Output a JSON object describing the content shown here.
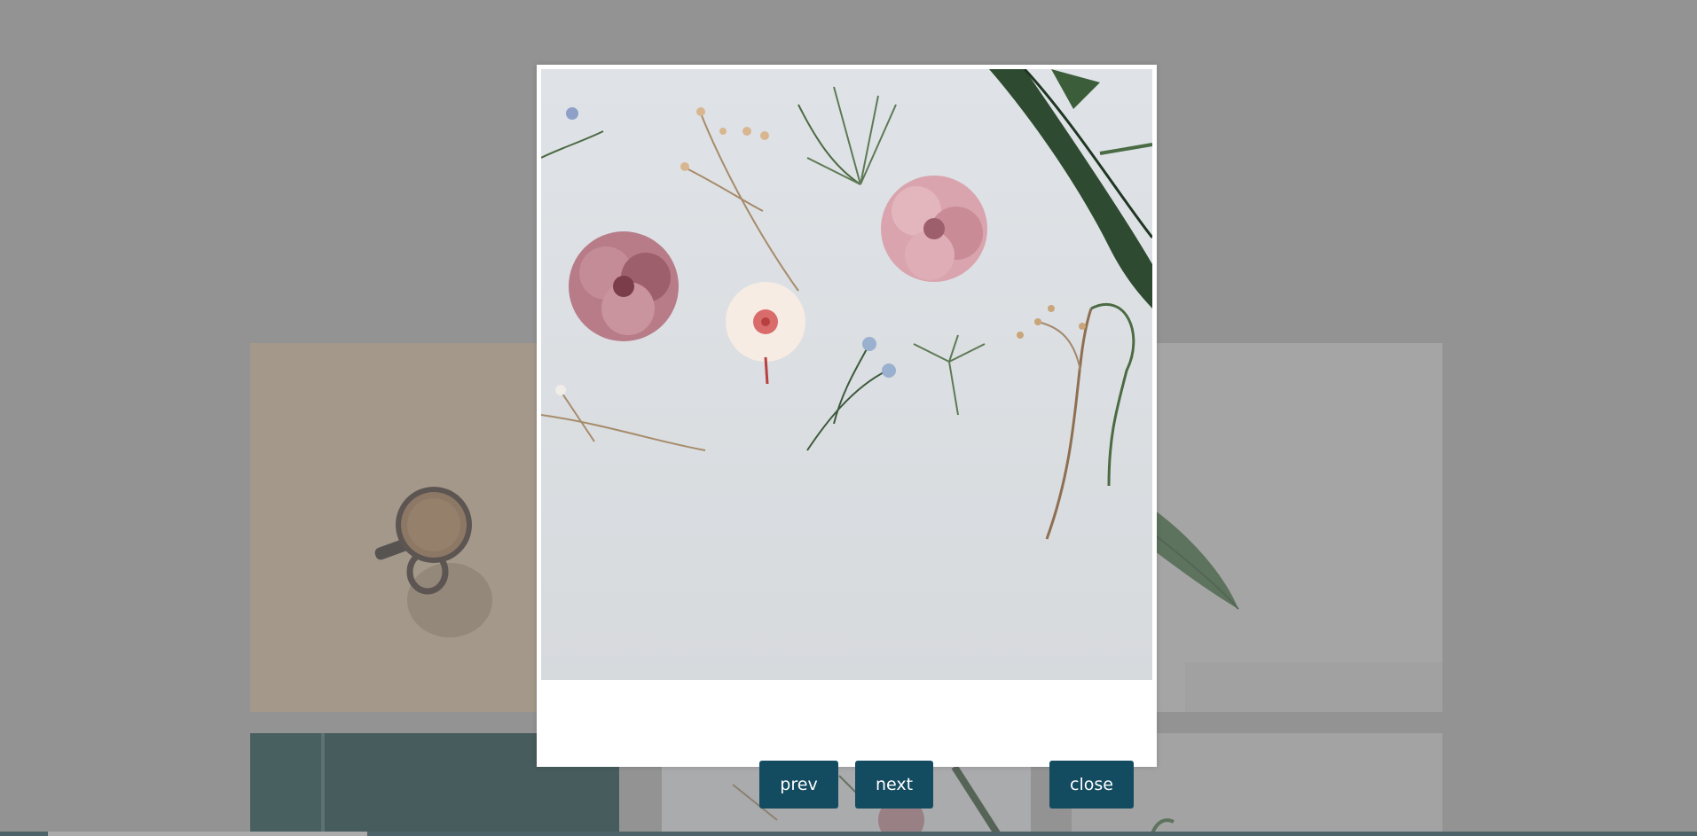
{
  "lightbox": {
    "prev_label": "prev",
    "next_label": "next",
    "close_label": "close",
    "image_icon": "pressed-flowers-photo"
  },
  "gallery": {
    "tiles": [
      {
        "icon": "coffee-cup-photo"
      },
      {
        "icon": "leaf-photo"
      },
      {
        "icon": "teal-wall-photo"
      },
      {
        "icon": "pressed-flowers-photo"
      },
      {
        "icon": "plant-photo"
      }
    ]
  },
  "colors": {
    "button_bg": "#134b60",
    "overlay": "rgba(120,120,120,0.55)",
    "strip": "#1a4a52"
  }
}
